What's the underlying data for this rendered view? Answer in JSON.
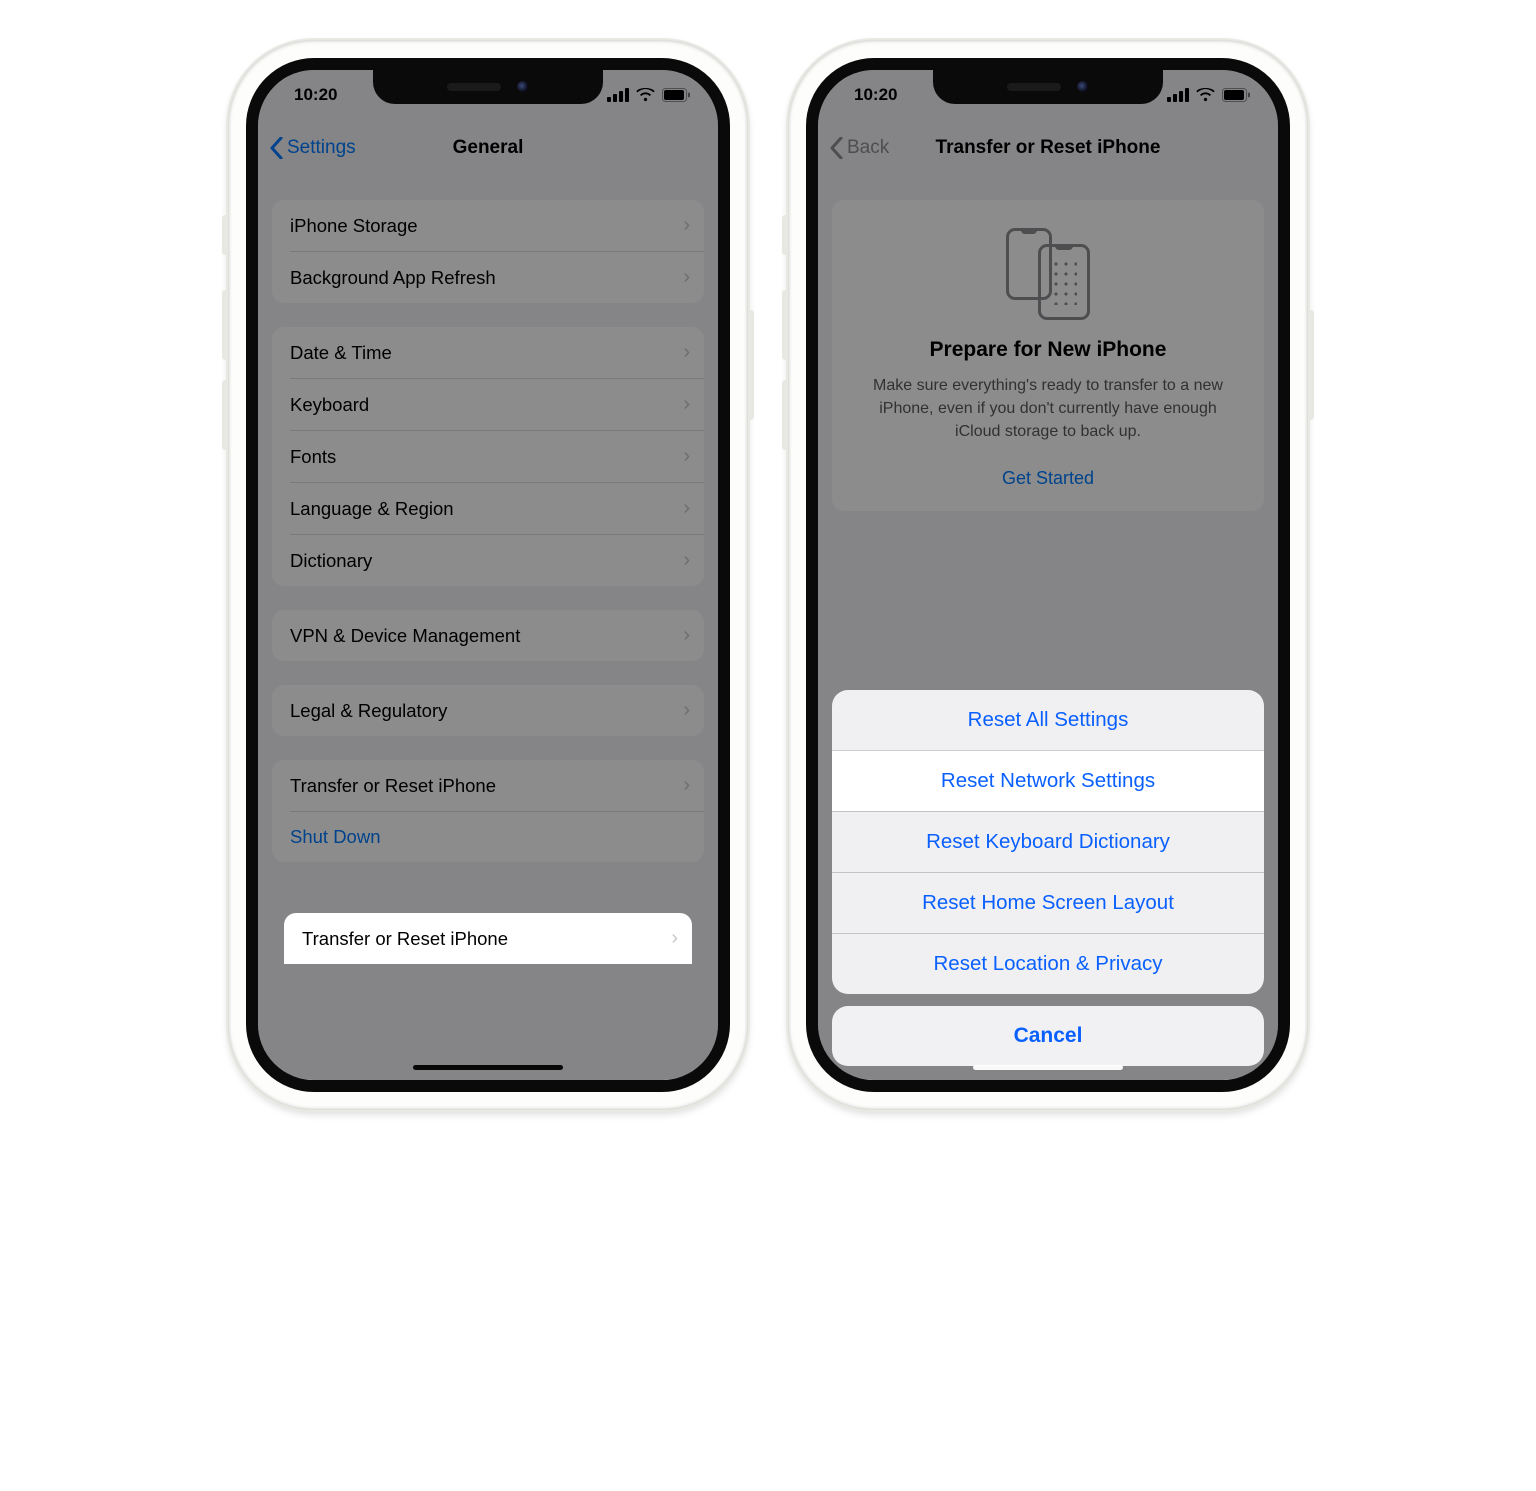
{
  "status": {
    "time": "10:20"
  },
  "phone1": {
    "back_label": "Settings",
    "title": "General",
    "groups": [
      {
        "rows": [
          {
            "label": "iPhone Storage"
          },
          {
            "label": "Background App Refresh"
          }
        ]
      },
      {
        "rows": [
          {
            "label": "Date & Time"
          },
          {
            "label": "Keyboard"
          },
          {
            "label": "Fonts"
          },
          {
            "label": "Language & Region"
          },
          {
            "label": "Dictionary"
          }
        ]
      },
      {
        "rows": [
          {
            "label": "VPN & Device Management"
          }
        ]
      },
      {
        "rows": [
          {
            "label": "Legal & Regulatory"
          }
        ]
      }
    ],
    "transfer_label": "Transfer or Reset iPhone",
    "shutdown_label": "Shut Down"
  },
  "phone2": {
    "back_label": "Back",
    "title": "Transfer or Reset iPhone",
    "prepare": {
      "title": "Prepare for New iPhone",
      "desc": "Make sure everything's ready to transfer to a new iPhone, even if you don't currently have enough iCloud storage to back up.",
      "cta": "Get Started"
    },
    "sheet": {
      "items": [
        "Reset All Settings",
        "Reset Network Settings",
        "Reset Keyboard Dictionary",
        "Reset Home Screen Layout",
        "Reset Location & Privacy"
      ],
      "highlight_index": 1,
      "cancel": "Cancel"
    }
  }
}
